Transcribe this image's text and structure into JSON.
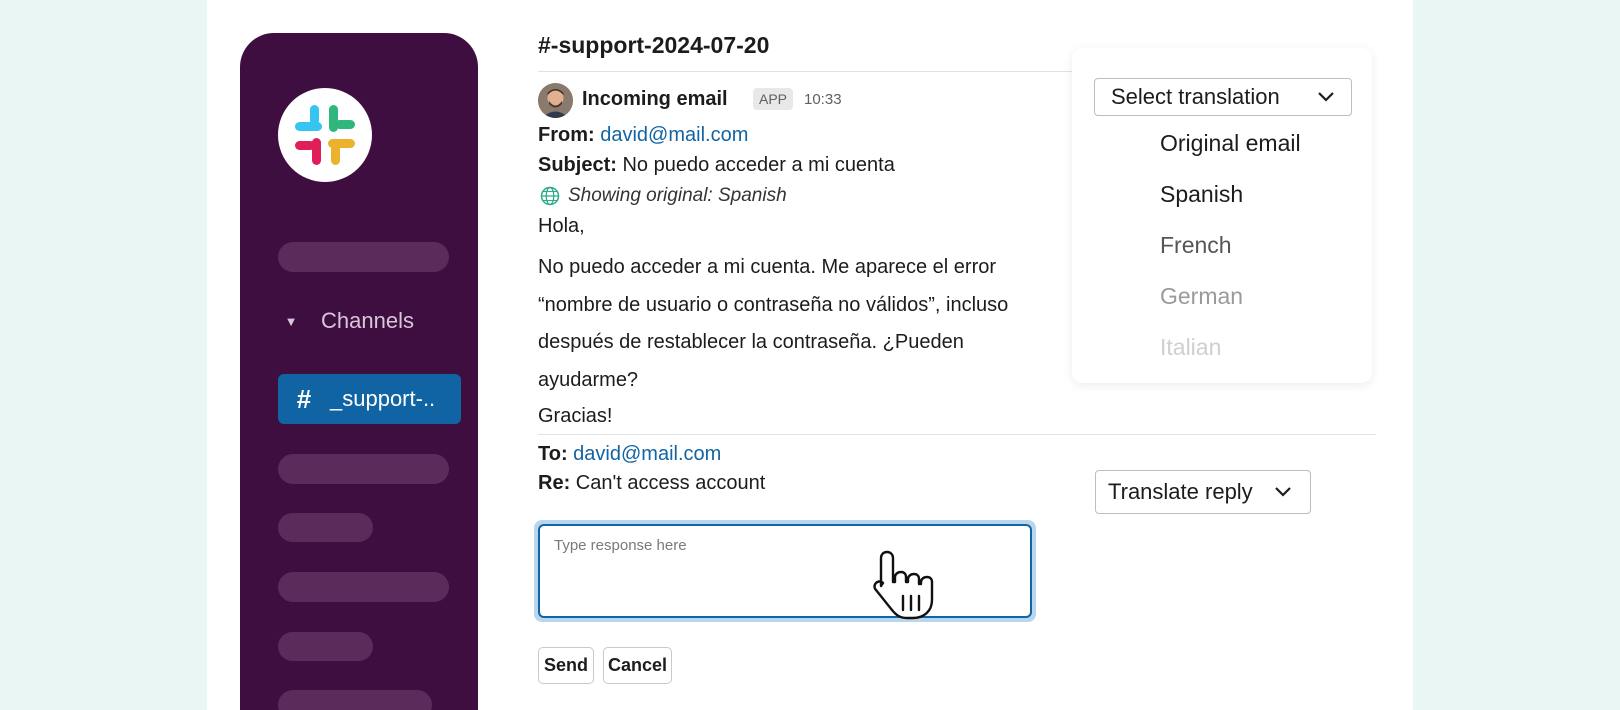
{
  "channel": {
    "title": "#-support-2024-07-20"
  },
  "sidebar": {
    "section_label": "Channels",
    "active_channel_label": "_support-.."
  },
  "message": {
    "sender": "Incoming email",
    "badge": "APP",
    "time": "10:33",
    "from_label": "From:",
    "from_email": "david@mail.com",
    "subject_label": "Subject:",
    "subject": "No puedo acceder a mi cuenta",
    "showing_original": "Showing original: Spanish",
    "greeting": "Hola,",
    "body": "No puedo acceder a mi cuenta. Me aparece el error “nombre de usuario o contraseña no válidos”, incluso después de restablecer la contraseña. ¿Pueden ayudarme?",
    "closing": "Gracias!"
  },
  "translation": {
    "select_label": "Select translation",
    "options": [
      {
        "label": "Original email",
        "color": "#1d1c1d"
      },
      {
        "label": "Spanish",
        "color": "#1d1c1d"
      },
      {
        "label": "French",
        "color": "#555555"
      },
      {
        "label": "German",
        "color": "#9a9a9a"
      },
      {
        "label": "Italian",
        "color": "#cfcfcf"
      }
    ]
  },
  "reply": {
    "to_label": "To:",
    "to_email": "david@mail.com",
    "re_label": "Re:",
    "re_subject": "Can't access account",
    "translate_label": "Translate reply",
    "placeholder": "Type response here",
    "send_label": "Send",
    "cancel_label": "Cancel"
  },
  "colors": {
    "sidebar": "#3f0e40",
    "active_channel": "#1164a3",
    "link": "#1264a3"
  }
}
